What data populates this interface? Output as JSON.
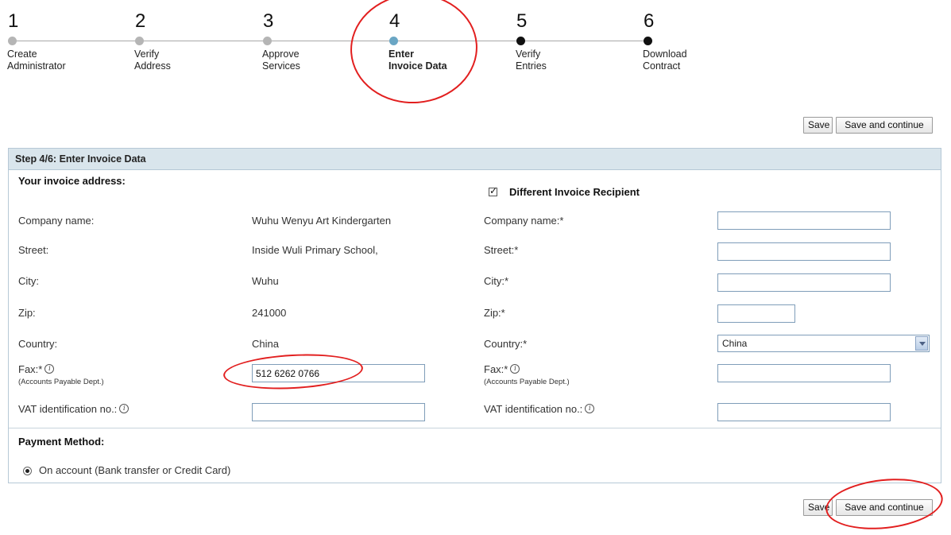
{
  "steps": [
    {
      "num": "1",
      "label": "Create\nAdministrator",
      "state": "done"
    },
    {
      "num": "2",
      "label": "Verify\nAddress",
      "state": "done"
    },
    {
      "num": "3",
      "label": "Approve\nServices",
      "state": "done"
    },
    {
      "num": "4",
      "label": "Enter\nInvoice Data",
      "state": "active"
    },
    {
      "num": "5",
      "label": "Verify\nEntries",
      "state": "todo"
    },
    {
      "num": "6",
      "label": "Download\nContract",
      "state": "todo"
    }
  ],
  "top_buttons": {
    "save": "Save",
    "save_continue": "Save and continue"
  },
  "bottom_buttons": {
    "save": "Save",
    "save_continue": "Save and continue"
  },
  "panel": {
    "title": "Step 4/6: Enter Invoice Data",
    "left": {
      "heading": "Your invoice address:",
      "company_label": "Company name:",
      "company_value": "Wuhu Wenyu Art Kindergarten",
      "street_label": "Street:",
      "street_value": "Inside Wuli Primary School,",
      "city_label": "City:",
      "city_value": "Wuhu",
      "zip_label": "Zip:",
      "zip_value": "241000",
      "country_label": "Country:",
      "country_value": "China",
      "fax_label": "Fax:*",
      "fax_sub": "(Accounts Payable Dept.)",
      "fax_value": "512 6262 0766",
      "vat_label": "VAT identification no.:",
      "vat_value": ""
    },
    "right": {
      "checkbox_label": "Different Invoice Recipient",
      "checkbox_checked": true,
      "company_label": "Company name:*",
      "street_label": "Street:*",
      "city_label": "City:*",
      "zip_label": "Zip:*",
      "country_label": "Country:*",
      "country_selected": "China",
      "fax_label": "Fax:*",
      "fax_sub": "(Accounts Payable Dept.)",
      "vat_label": "VAT identification no.:",
      "company_value": "",
      "street_value": "",
      "city_value": "",
      "zip_value": "",
      "fax_value": "",
      "vat_value": ""
    },
    "payment": {
      "heading": "Payment Method:",
      "option": "On account (Bank transfer or Credit Card)"
    }
  },
  "icons": {
    "info": "info-icon",
    "dropdown": "chevron-down-icon",
    "check": "checkmark-icon"
  },
  "colors": {
    "panel_header": "#d9e5ec",
    "active_step": "#6aa6c4",
    "annotation": "#e21f1f"
  }
}
